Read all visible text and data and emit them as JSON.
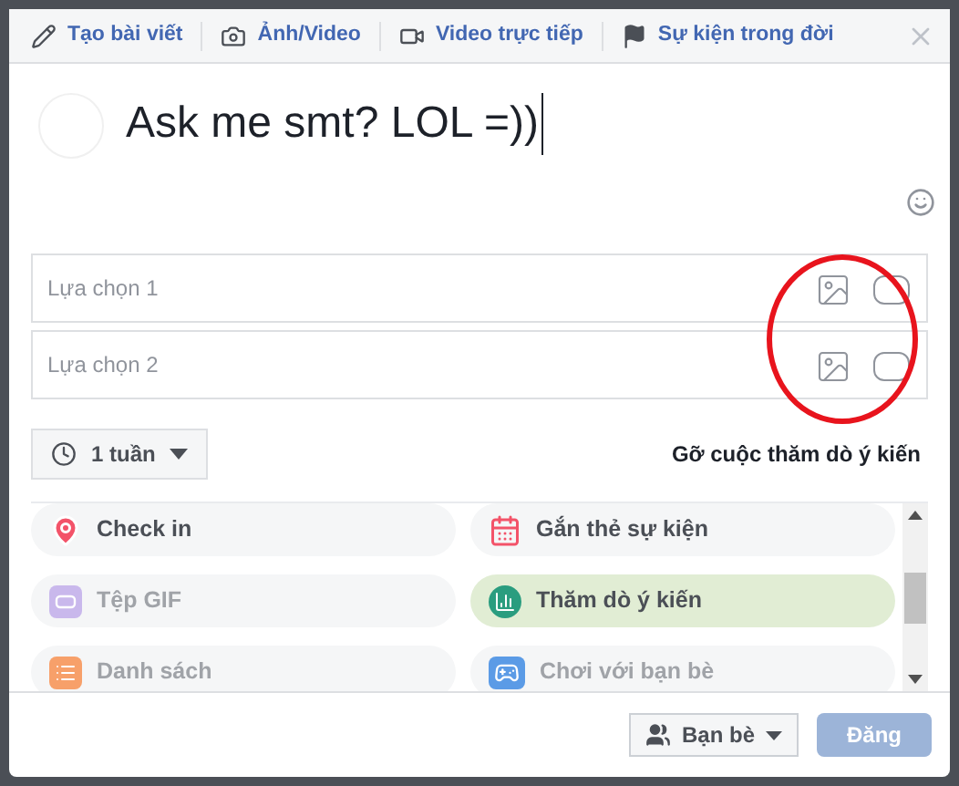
{
  "header_tabs": [
    {
      "label": "Tạo bài viết",
      "kind": "pencil"
    },
    {
      "label": "Ảnh/Video",
      "kind": "camera"
    },
    {
      "label": "Video trực tiếp",
      "kind": "video"
    },
    {
      "label": "Sự kiện trong đời",
      "kind": "flag"
    }
  ],
  "composer": {
    "value": "Ask me smt? LOL =))"
  },
  "poll_options": [
    {
      "placeholder": "Lựa chọn 1"
    },
    {
      "placeholder": "Lựa chọn 2"
    }
  ],
  "duration": {
    "label": "1 tuần"
  },
  "remove_poll": "Gỡ cuộc thăm dò ý kiến",
  "actions": [
    {
      "label": "Check in",
      "kind": "pin",
      "selected": false,
      "disabled": false
    },
    {
      "label": "Gắn thẻ sự kiện",
      "kind": "calendar",
      "selected": false,
      "disabled": false
    },
    {
      "label": "Tệp GIF",
      "kind": "gif",
      "selected": false,
      "disabled": true
    },
    {
      "label": "Thăm dò ý kiến",
      "kind": "poll",
      "selected": true,
      "disabled": false
    },
    {
      "label": "Danh sách",
      "kind": "list",
      "selected": false,
      "disabled": true
    },
    {
      "label": "Chơi với bạn bè",
      "kind": "game",
      "selected": false,
      "disabled": true
    }
  ],
  "audience": {
    "label": "Bạn bè"
  },
  "post_button": {
    "label": "Đăng",
    "disabled": true
  }
}
